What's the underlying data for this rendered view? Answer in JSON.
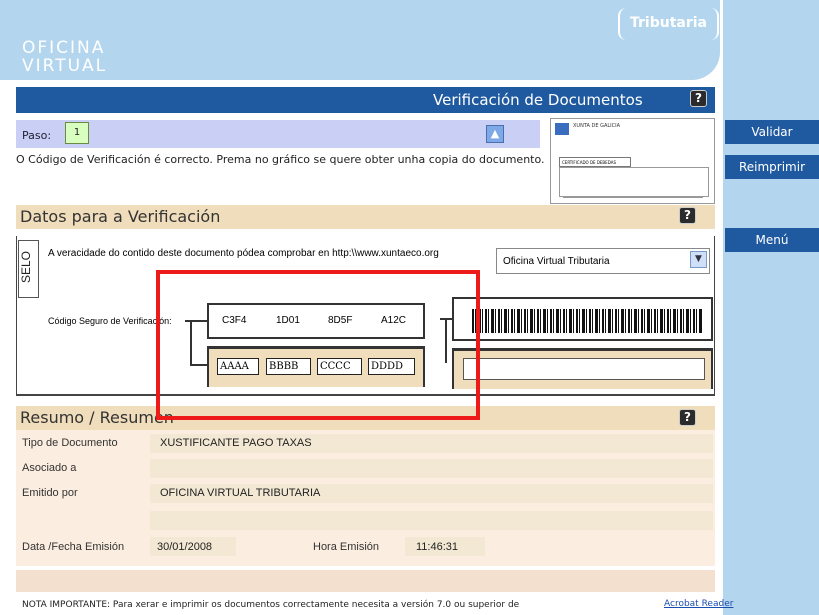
{
  "header": {
    "logo_line1": "OFICINA",
    "logo_line2": "VIRTUAL",
    "brand": "Tributaria"
  },
  "sidebar": {
    "validar": "Validar",
    "reimprimir": "Reimprimir",
    "menu": "Menú"
  },
  "title": "Verificación de Documentos",
  "help_icon": "?",
  "paso": {
    "label": "Paso:",
    "value": "1"
  },
  "message": "O Código de Verificación é correcto. Prema no gráfico se quere obter unha copia do documento.",
  "thumbnail": {
    "org": "XUNTA DE GALICIA",
    "doc": "CERTIFICADO DE DEBEDAS"
  },
  "datos": {
    "title": "Datos para a Verificación",
    "selo": "SELO",
    "veracidade": "A veracidade do contido deste documento pódea comprobar en http:\\\\www.xuntaeco.org",
    "select_value": "Oficina Virtual Tributaria",
    "csv_label": "Código Seguro de Verificación:",
    "csv_parts": [
      "C3F4",
      "1D01",
      "8D5F",
      "A12C"
    ],
    "input_boxes": [
      "AAAA",
      "BBBB",
      "CCCC",
      "DDDD"
    ]
  },
  "resumo": {
    "title": "Resumo / Resumen",
    "tipo_label": "Tipo de Documento",
    "tipo_value": "XUSTIFICANTE PAGO TAXAS",
    "asociado_label": "Asociado a",
    "asociado_value": "",
    "emitido_label": "Emitido por",
    "emitido_value": "OFICINA VIRTUAL TRIBUTARIA",
    "data_label": "Data /Fecha Emisión",
    "data_value": "30/01/2008",
    "hora_label": "Hora Emisión",
    "hora_value": "11:46:31"
  },
  "footer": {
    "note": "NOTA IMPORTANTE: Para xerar e imprimir os documentos correctamente necesita a versión 7.0 ou superior de",
    "link": "Acrobat Reader"
  },
  "colors": {
    "navy": "#1f5aa0",
    "sky": "#b3d6ee",
    "beige": "#f0ddbb",
    "annotation": "#ee1a1a"
  }
}
